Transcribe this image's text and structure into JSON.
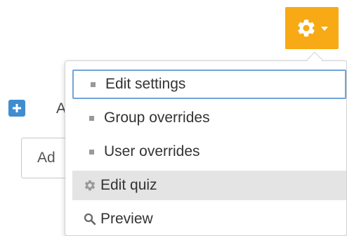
{
  "toolbar": {
    "actions_button": {
      "icon": "gear-icon",
      "caret_icon": "caret-down-icon",
      "background_color": "#f7aa16"
    }
  },
  "background_content": {
    "add_icon": "plus-square-icon",
    "add_label": "A",
    "add_field_text": "Ad"
  },
  "dropdown": {
    "items": [
      {
        "label": "Edit settings",
        "icon": "bullet-icon",
        "state": "focused"
      },
      {
        "label": "Group overrides",
        "icon": "bullet-icon"
      },
      {
        "label": "User overrides",
        "icon": "bullet-icon"
      },
      {
        "label": "Edit quiz",
        "icon": "gear-icon",
        "state": "highlighted"
      },
      {
        "label": "Preview",
        "icon": "search-icon"
      }
    ]
  }
}
